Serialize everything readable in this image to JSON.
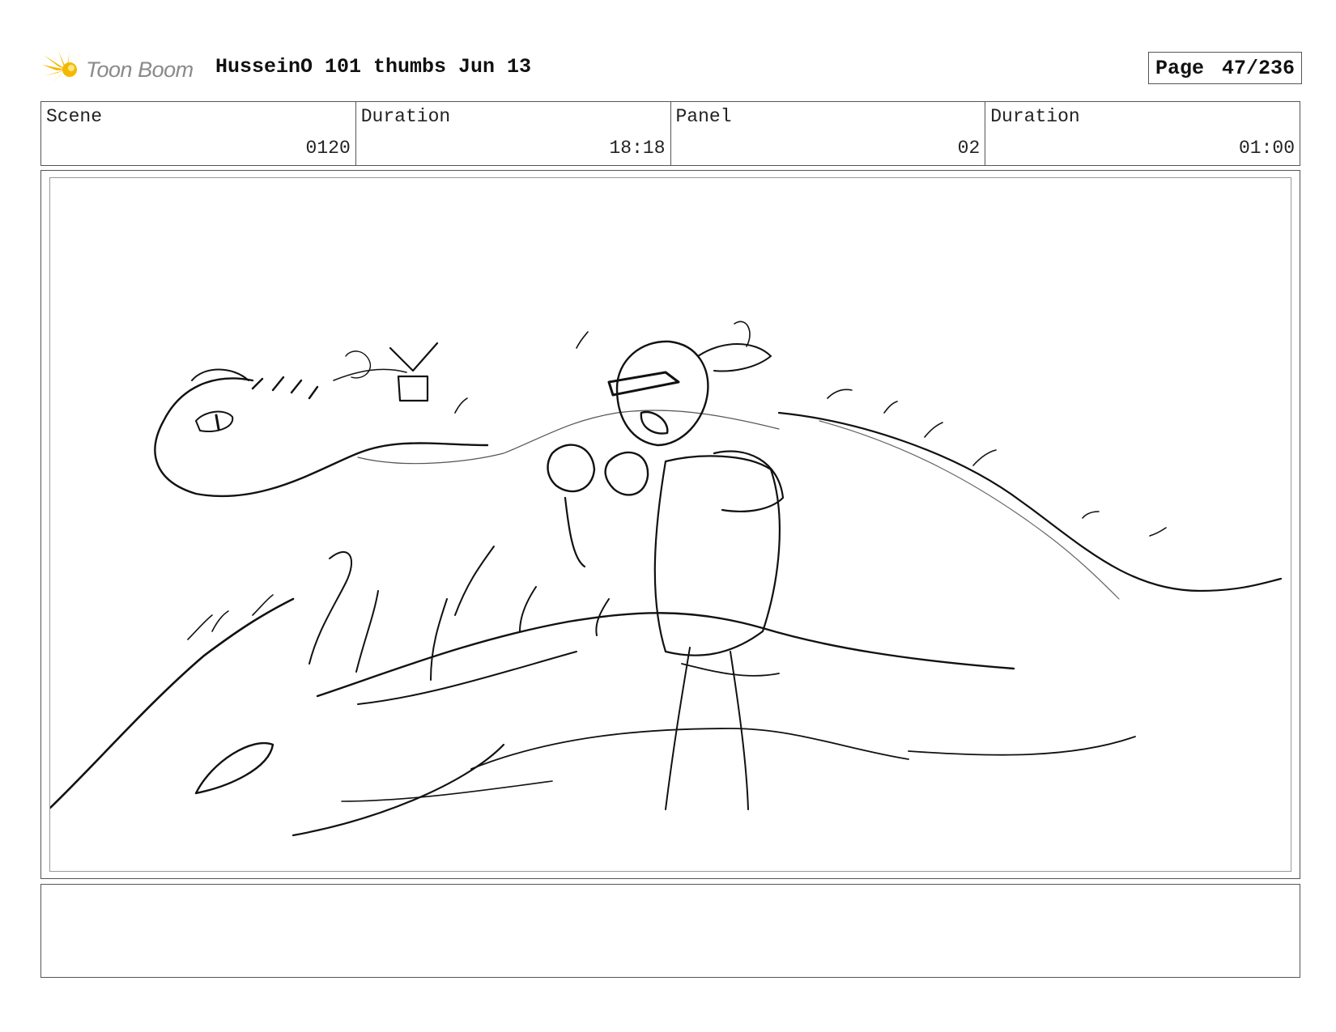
{
  "header": {
    "logo_text": "Toon Boom",
    "logo_color": "#f5b800",
    "title": "HusseinO 101 thumbs Jun 13",
    "page_label": "Page",
    "page_value": "47/236"
  },
  "info": {
    "scene_label": "Scene",
    "scene_value": "0120",
    "scene_duration_label": "Duration",
    "scene_duration_value": "18:18",
    "panel_label": "Panel",
    "panel_value": "02",
    "panel_duration_label": "Duration",
    "panel_duration_value": "01:00"
  },
  "panel": {
    "image": "pencil-sketch-panel"
  },
  "notes": {
    "text": ""
  }
}
